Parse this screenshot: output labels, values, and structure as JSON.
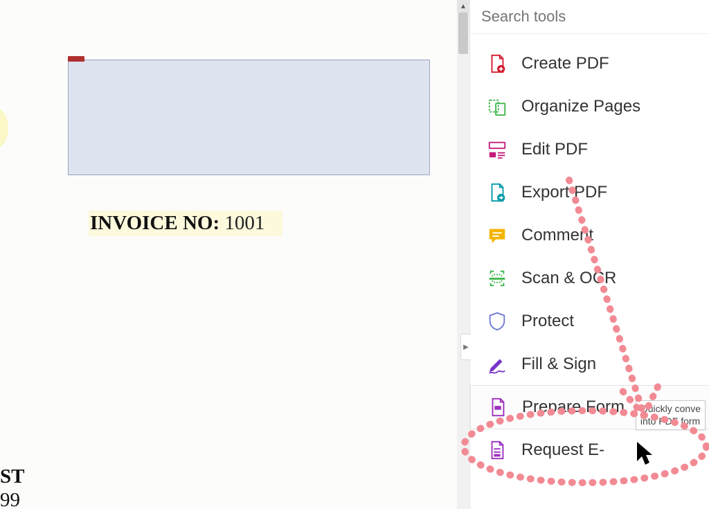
{
  "document": {
    "invoice_label": "INVOICE NO: ",
    "invoice_value": "1001",
    "bottom_line1": "ST",
    "bottom_line2": "99"
  },
  "panel": {
    "search_placeholder": "Search tools",
    "expander_glyph": "▶",
    "scroll_up_glyph": "▲",
    "tools": [
      {
        "label": "Create PDF",
        "icon": "create-pdf"
      },
      {
        "label": "Organize Pages",
        "icon": "organize-pages"
      },
      {
        "label": "Edit PDF",
        "icon": "edit-pdf"
      },
      {
        "label": "Export PDF",
        "icon": "export-pdf"
      },
      {
        "label": "Comment",
        "icon": "comment"
      },
      {
        "label": "Scan & OCR",
        "icon": "scan-ocr"
      },
      {
        "label": "Protect",
        "icon": "protect"
      },
      {
        "label": "Fill & Sign",
        "icon": "fill-sign"
      },
      {
        "label": "Prepare Form",
        "icon": "prepare-form",
        "selected": true
      },
      {
        "label": "Request E-",
        "icon": "request-esign"
      }
    ],
    "tooltip": "Quickly conve\ninto PDF form"
  },
  "colors": {
    "accent_red": "#d11b2d",
    "accent_green": "#3fb64a",
    "accent_magenta": "#c31c7b",
    "accent_teal": "#009ba8",
    "accent_yellow": "#f3b400",
    "accent_purple": "#7a35c9",
    "annotation_pink": "#f28a94"
  }
}
